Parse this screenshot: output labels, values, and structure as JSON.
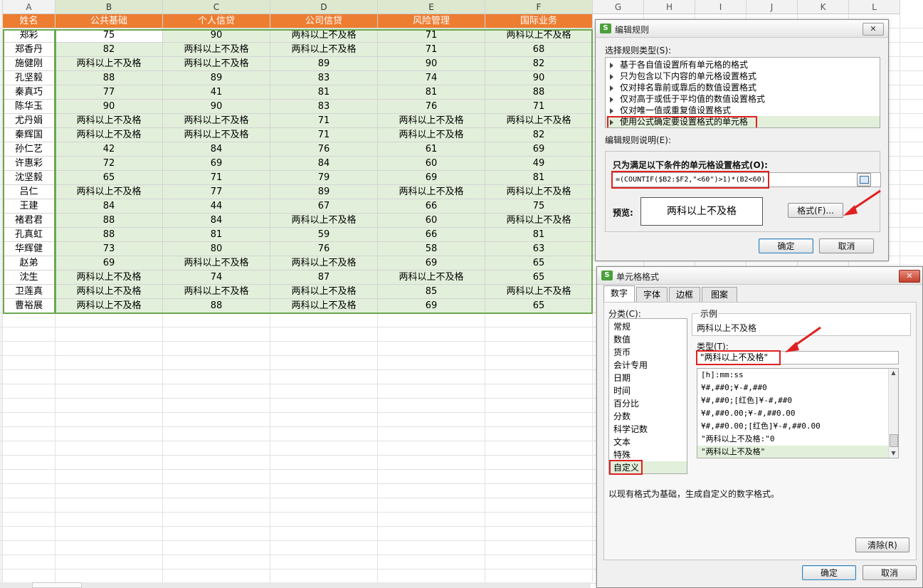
{
  "sheet": {
    "row_headers_label": "",
    "columns": [
      "A",
      "B",
      "C",
      "D",
      "E",
      "F",
      "G",
      "H",
      "I",
      "J",
      "K",
      "L"
    ],
    "table_headers": [
      "姓名",
      "公共基础",
      "个人信贷",
      "公司信贷",
      "风险管理",
      "国际业务"
    ],
    "rows": [
      [
        "郑彩",
        "75",
        "90",
        "两科以上不及格",
        "71",
        "两科以上不及格"
      ],
      [
        "郑香丹",
        "82",
        "两科以上不及格",
        "两科以上不及格",
        "71",
        "68"
      ],
      [
        "施健刚",
        "两科以上不及格",
        "两科以上不及格",
        "89",
        "90",
        "82"
      ],
      [
        "孔坚毅",
        "88",
        "89",
        "83",
        "74",
        "90"
      ],
      [
        "秦真巧",
        "77",
        "41",
        "81",
        "81",
        "88"
      ],
      [
        "陈华玉",
        "90",
        "90",
        "83",
        "76",
        "71"
      ],
      [
        "尤丹娟",
        "两科以上不及格",
        "两科以上不及格",
        "71",
        "两科以上不及格",
        "两科以上不及格"
      ],
      [
        "秦辉国",
        "两科以上不及格",
        "两科以上不及格",
        "71",
        "两科以上不及格",
        "82"
      ],
      [
        "孙仁艺",
        "42",
        "84",
        "76",
        "61",
        "69"
      ],
      [
        "许惠彩",
        "72",
        "69",
        "84",
        "60",
        "49"
      ],
      [
        "沈坚毅",
        "65",
        "71",
        "79",
        "69",
        "81"
      ],
      [
        "吕仁",
        "两科以上不及格",
        "77",
        "89",
        "两科以上不及格",
        "两科以上不及格"
      ],
      [
        "王建",
        "84",
        "44",
        "67",
        "66",
        "75"
      ],
      [
        "褚君君",
        "88",
        "84",
        "两科以上不及格",
        "60",
        "两科以上不及格"
      ],
      [
        "孔真虹",
        "88",
        "81",
        "59",
        "66",
        "81"
      ],
      [
        "华辉健",
        "73",
        "80",
        "76",
        "58",
        "63"
      ],
      [
        "赵弟",
        "69",
        "两科以上不及格",
        "两科以上不及格",
        "69",
        "65"
      ],
      [
        "沈生",
        "两科以上不及格",
        "74",
        "87",
        "两科以上不及格",
        "65"
      ],
      [
        "卫莲真",
        "两科以上不及格",
        "两科以上不及格",
        "两科以上不及格",
        "85",
        "两科以上不及格"
      ],
      [
        "曹裕展",
        "两科以上不及格",
        "88",
        "两科以上不及格",
        "69",
        "65"
      ]
    ],
    "colors": {
      "header_bg": "#ed7d31",
      "data_bg": "#e2efda",
      "selection_border": "#6aa84f"
    }
  },
  "rule_dialog": {
    "title": "编辑规则",
    "close_label": "✕",
    "select_type_label": "选择规则类型(S):",
    "rule_types": [
      "基于各自值设置所有单元格的格式",
      "只为包含以下内容的单元格设置格式",
      "仅对排名靠前或靠后的数值设置格式",
      "仅对高于或低于平均值的数值设置格式",
      "仅对唯一值或重复值设置格式",
      "使用公式确定要设置格式的单元格"
    ],
    "edit_desc_label": "编辑规则说明(E):",
    "condition_label": "只为满足以下条件的单元格设置格式(O):",
    "formula": "=(COUNTIF($B2:$F2,\"<60\")>1)*(B2<60)",
    "preview_label": "预览:",
    "preview_text": "两科以上不及格",
    "format_button": "格式(F)...",
    "ok": "确定",
    "cancel": "取消"
  },
  "cell_dialog": {
    "title": "单元格格式",
    "close_label": "✕",
    "tabs": [
      "数字",
      "字体",
      "边框",
      "图案"
    ],
    "category_label": "分类(C):",
    "categories": [
      "常规",
      "数值",
      "货币",
      "会计专用",
      "日期",
      "时间",
      "百分比",
      "分数",
      "科学记数",
      "文本",
      "特殊",
      "自定义"
    ],
    "sample_label": "示例",
    "sample_value": "两科以上不及格",
    "type_label": "类型(T):",
    "type_value": "\"两科以上不及格\"",
    "format_list": [
      "[h]:mm:ss",
      "¥#,##0;¥-#,##0",
      "¥#,##0;[红色]¥-#,##0",
      "¥#,##0.00;¥-#,##0.00",
      "¥#,##0.00;[红色]¥-#,##0.00",
      "\"两科以上不及格:\"0",
      "\"两科以上不及格\""
    ],
    "description": "以现有格式为基础，生成自定义的数字格式。",
    "clear_button": "清除(R)",
    "ok": "确定",
    "cancel": "取消"
  }
}
